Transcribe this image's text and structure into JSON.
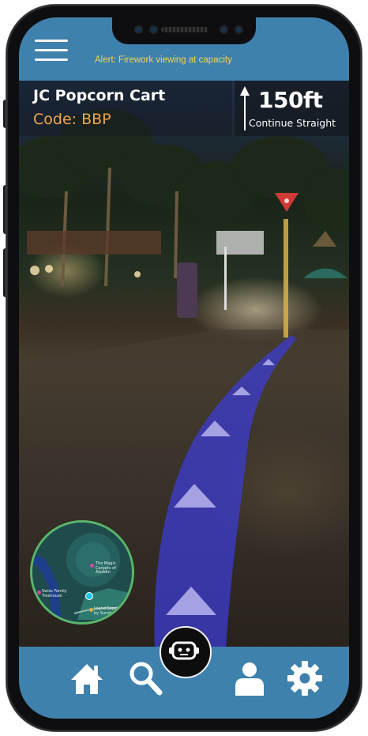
{
  "header": {
    "alert": "Alert: Firework viewing at capacity"
  },
  "destination": {
    "name": "JC Popcorn Cart",
    "code": "Code: BBP"
  },
  "direction": {
    "distance": "150ft",
    "instruction": "Continue Straight"
  },
  "minimap": {
    "labels": [
      "The Magic Carpets of Aladdin",
      "Swiss Family Treehouse",
      "Island Supplies by Sunsh…"
    ]
  },
  "bottom_nav": {
    "items": [
      "home-icon",
      "search-icon",
      "robot-assistant-icon",
      "profile-icon",
      "settings-icon"
    ]
  },
  "colors": {
    "bar": "#3f81ad",
    "alert": "#f2d54a",
    "code": "#f1a64a",
    "path": "#3c3cd2",
    "destination_marker": "#e53b3b",
    "minimap_border": "#5ab56a"
  }
}
